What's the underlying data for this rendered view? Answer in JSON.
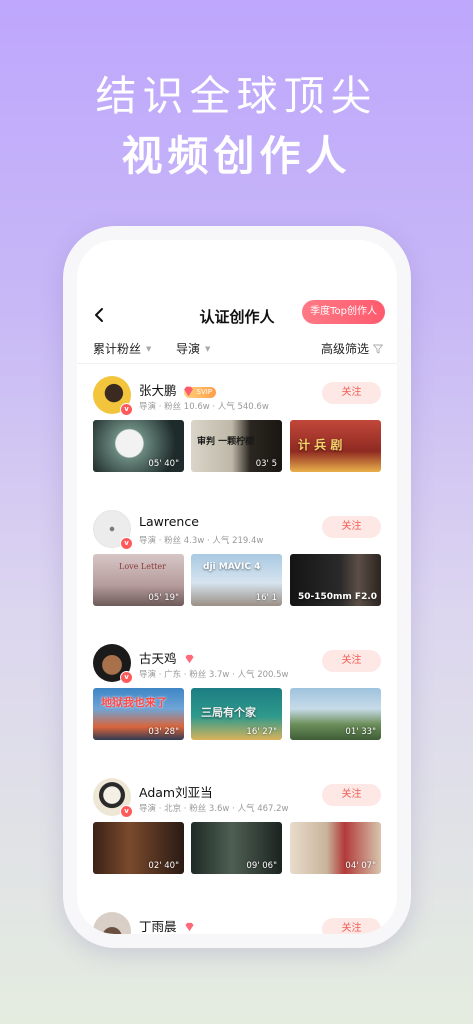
{
  "hero": {
    "line1": "结识全球顶尖",
    "line2": "视频创作人"
  },
  "nav": {
    "title": "认证创作人",
    "top_button": "季度Top创作人"
  },
  "filters": {
    "followers": "累计粉丝",
    "role": "导演",
    "advanced": "高级筛选"
  },
  "follow_label": "关注",
  "creators": [
    {
      "name": "张大鹏",
      "badge": "SVIP",
      "meta": "导演 · 粉丝 10.6w · 人气 540.6w",
      "videos": [
        {
          "duration": "05' 40\""
        },
        {
          "duration": "03' 5",
          "caption": "审判 一颗柠檬"
        },
        {
          "duration": "",
          "caption": "计 兵 剧"
        }
      ]
    },
    {
      "name": "Lawrence",
      "meta": "导演 · 粉丝 4.3w · 人气 219.4w",
      "videos": [
        {
          "duration": "05' 19\"",
          "caption": "Love Letter"
        },
        {
          "duration": "16' 1",
          "caption": "dji MAVIC 4"
        },
        {
          "duration": "",
          "caption": "50-150mm F2.0"
        }
      ]
    },
    {
      "name": "古天鸡",
      "meta": "导演 · 广东 · 粉丝 3.7w · 人气 200.5w",
      "videos": [
        {
          "duration": "03' 28\"",
          "caption": "地狱我也来了"
        },
        {
          "duration": "16' 27\"",
          "caption": "三局有个家"
        },
        {
          "duration": "01' 33\""
        }
      ]
    },
    {
      "name": "Adam刘亚当",
      "meta": "导演 · 北京 · 粉丝 3.6w · 人气 467.2w",
      "videos": [
        {
          "duration": "02' 40\""
        },
        {
          "duration": "09' 06\""
        },
        {
          "duration": "04' 07\""
        }
      ]
    },
    {
      "name": "丁雨晨",
      "meta": "",
      "videos": []
    }
  ],
  "colors": {
    "accent": "#f25c54",
    "follow_bg": "#fde8e6",
    "top_button": "#ff5a6e"
  }
}
